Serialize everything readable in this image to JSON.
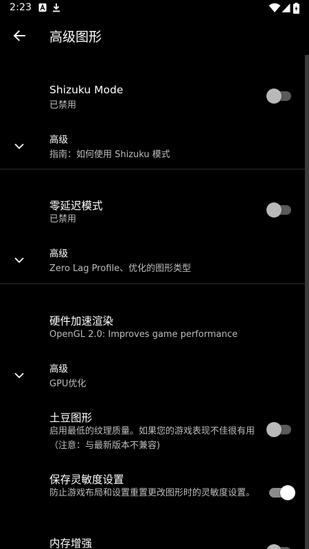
{
  "status_bar": {
    "time": "2:23"
  },
  "app_bar": {
    "title": "高级图形"
  },
  "colors": {
    "background": "#000000",
    "primary_text": "#ffffff",
    "secondary_text": "#bdbdbd",
    "divider": "#2c2c2c",
    "switch_off_thumb": "#b9b9b9",
    "switch_on_thumb": "#ffffff"
  },
  "settings": [
    {
      "title": "Shizuku Mode",
      "summary": "已禁用",
      "switch_on": false,
      "advanced_title": "高级",
      "advanced_summary": "指南：如何使用 Shizuku 模式"
    },
    {
      "title": "零延迟模式",
      "summary": "已禁用",
      "switch_on": false,
      "advanced_title": "高级",
      "advanced_summary": "Zero Lag Profile、优化的图形类型"
    },
    {
      "title": "硬件加速渲染",
      "summary": "OpenGL 2.0: Improves game performance",
      "advanced_title": "高级",
      "advanced_summary": "GPU优化"
    }
  ],
  "gpu_options": [
    {
      "title": "土豆图形",
      "summary": "启用最低的纹理质量。如果您的游戏表现不佳很有用 （注意：与最新版本不兼容)",
      "switch_on": false
    },
    {
      "title": "保存灵敏度设置",
      "summary": "防止游戏布局和设置重置更改图形时的灵敏度设置。",
      "switch_on": true
    },
    {
      "title": "内存增强",
      "summary": "",
      "switch_on": false
    }
  ]
}
